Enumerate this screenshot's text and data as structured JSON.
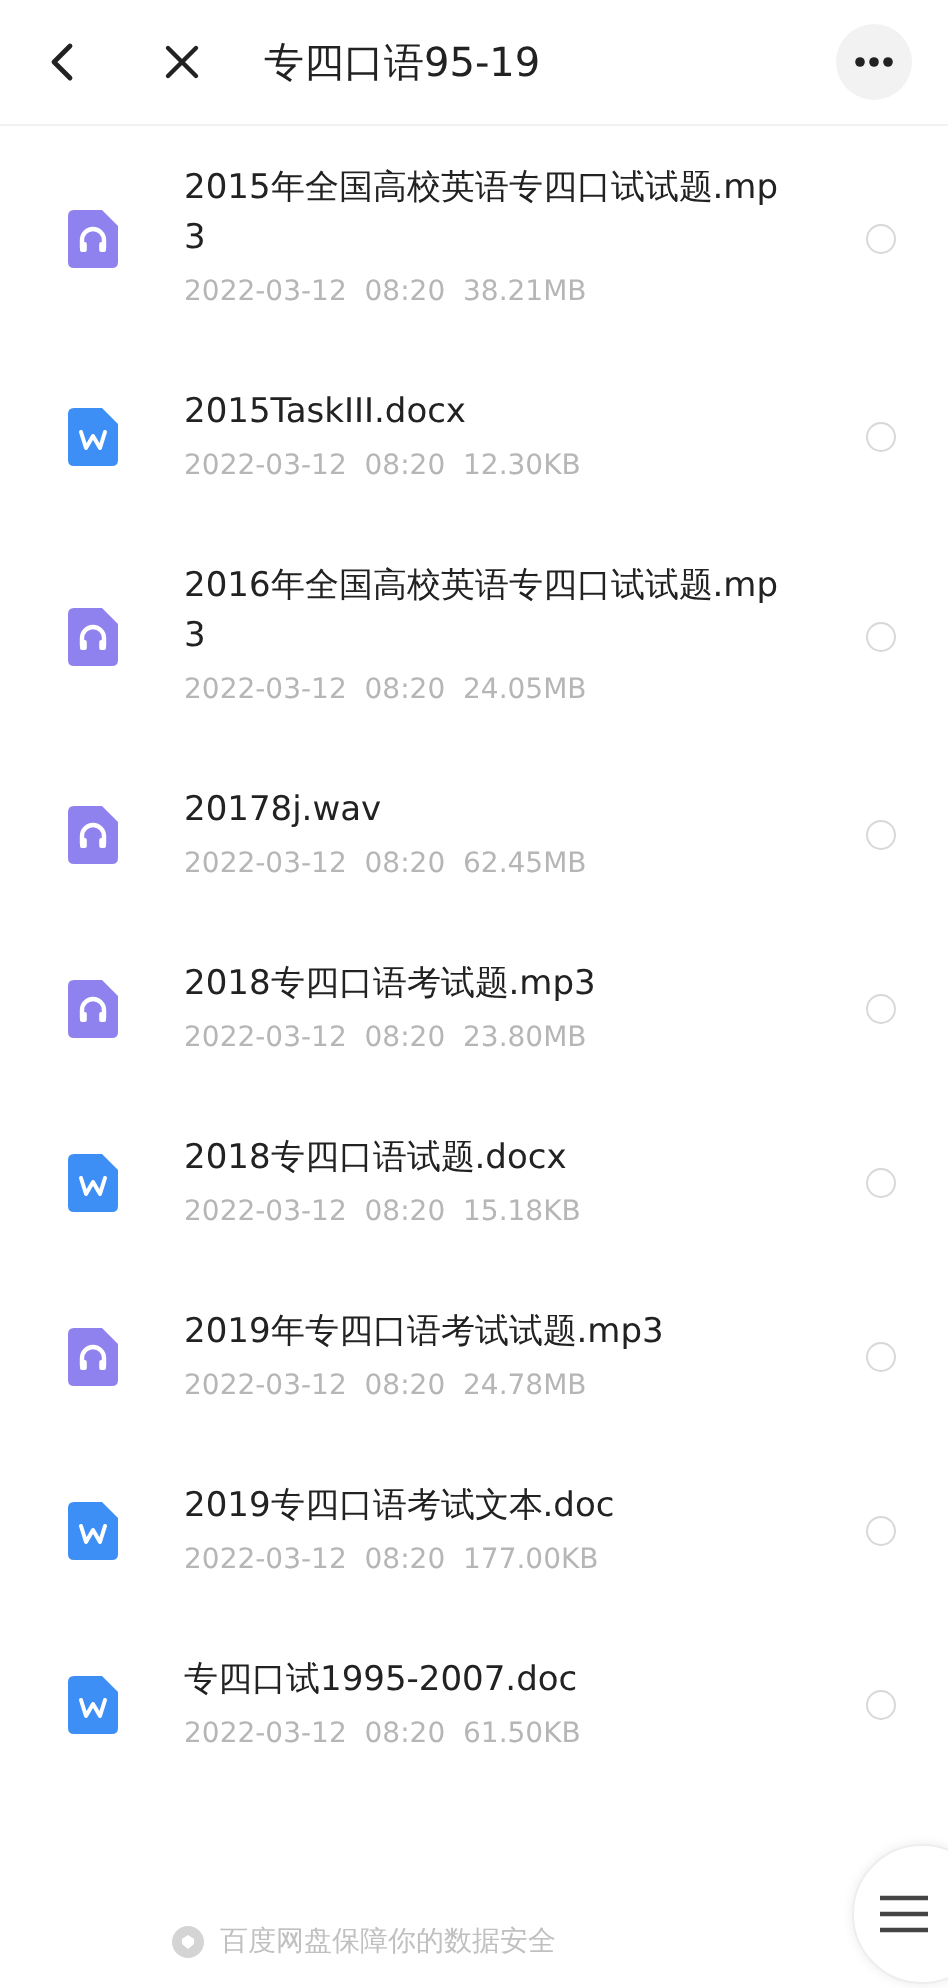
{
  "header": {
    "title": "专四口语95-19"
  },
  "files": [
    {
      "kind": "audio",
      "name": "2015年全国高校英语专四口试试题.mp3",
      "date": "2022-03-12",
      "time": "08:20",
      "size": "38.21MB",
      "selected": false
    },
    {
      "kind": "word",
      "name": "2015TaskIII.docx",
      "date": "2022-03-12",
      "time": "08:20",
      "size": "12.30KB",
      "selected": false
    },
    {
      "kind": "audio",
      "name": "2016年全国高校英语专四口试试题.mp3",
      "date": "2022-03-12",
      "time": "08:20",
      "size": "24.05MB",
      "selected": false
    },
    {
      "kind": "audio",
      "name": "20178j.wav",
      "date": "2022-03-12",
      "time": "08:20",
      "size": "62.45MB",
      "selected": false
    },
    {
      "kind": "audio",
      "name": "2018专四口语考试题.mp3",
      "date": "2022-03-12",
      "time": "08:20",
      "size": "23.80MB",
      "selected": false
    },
    {
      "kind": "word",
      "name": "2018专四口语试题.docx",
      "date": "2022-03-12",
      "time": "08:20",
      "size": "15.18KB",
      "selected": false
    },
    {
      "kind": "audio",
      "name": "2019年专四口语考试试题.mp3",
      "date": "2022-03-12",
      "time": "08:20",
      "size": "24.78MB",
      "selected": false
    },
    {
      "kind": "word",
      "name": "2019专四口语考试文本.doc",
      "date": "2022-03-12",
      "time": "08:20",
      "size": "177.00KB",
      "selected": false
    },
    {
      "kind": "word",
      "name": "专四口试1995-2007.doc",
      "date": "2022-03-12",
      "time": "08:20",
      "size": "61.50KB",
      "selected": false
    }
  ],
  "footer": {
    "notice": "百度网盘保障你的数据安全"
  }
}
